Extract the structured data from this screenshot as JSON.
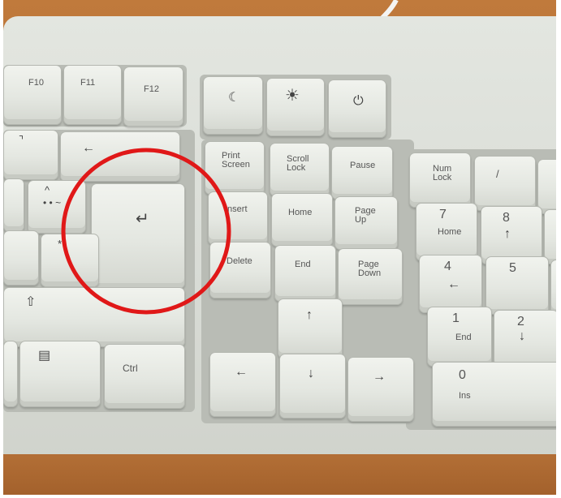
{
  "photo": {
    "subject": "keyboard-closeup",
    "highlight_color": "#e01818",
    "keys": {
      "f10": "F10",
      "f11": "F11",
      "f12": "F12",
      "print_screen": "Print\nScreen",
      "scroll_lock": "Scroll\nLock",
      "pause": "Pause",
      "num_lock": "Num\nLock",
      "slash": "/",
      "insert": "Insert",
      "home": "Home",
      "page_up": "Page\nUp",
      "delete": "Delete",
      "end": "End",
      "page_down": "Page\nDown",
      "np7": "7",
      "np7_sub": "Home",
      "np8": "8",
      "np4": "4",
      "np5": "5",
      "np1": "1",
      "np1_sub": "End",
      "np2": "2",
      "np0": "0",
      "np0_sub": "Ins",
      "ctrl": "Ctrl"
    }
  }
}
